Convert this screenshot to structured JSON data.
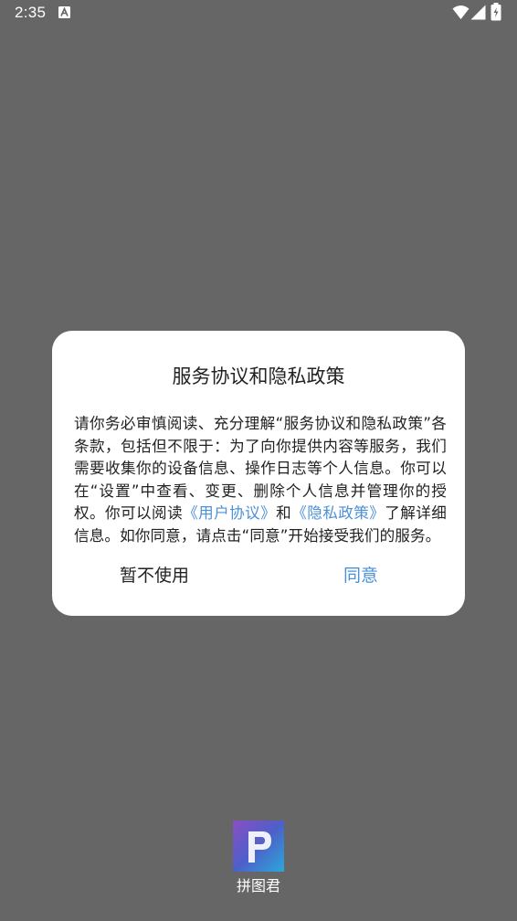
{
  "status_bar": {
    "time": "2:35",
    "notification_icon": "app-notification-icon",
    "wifi_icon": "wifi-icon",
    "signal_icon": "cell-signal-icon",
    "battery_icon": "battery-charging-icon"
  },
  "dialog": {
    "title": "服务协议和隐私政策",
    "body_before": "请你务必审慎阅读、充分理解“服务协议和隐私政策”各条款，包括但不限于：为了向你提供内容等服务，我们需要收集你的设备信息、操作日志等个人信息。你可以在“设置”中查看、变更、删除个人信息并管理你的授权。你可以阅读",
    "user_agreement_link": "《用户协议》",
    "body_and": "和",
    "privacy_policy_link": "《隐私政策》",
    "body_after": "了解详细信息。如你同意，请点击“同意”开始接受我们的服务。",
    "decline_label": "暂不使用",
    "agree_label": "同意"
  },
  "app": {
    "name": "拼图君",
    "logo_letter": "P"
  },
  "colors": {
    "background": "#666666",
    "link": "#4c90d9",
    "text": "#222222"
  }
}
